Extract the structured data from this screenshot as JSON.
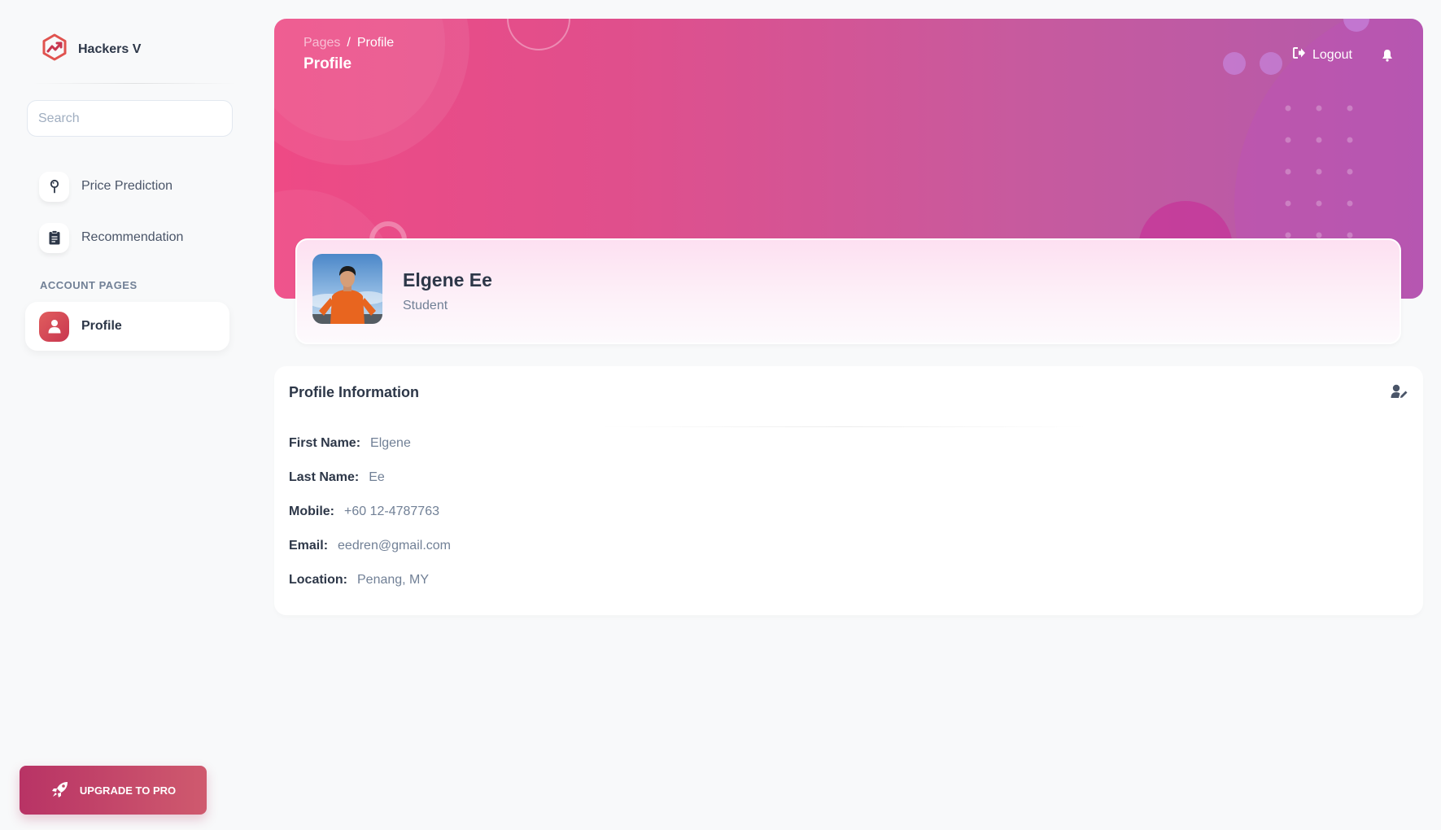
{
  "brand": {
    "name": "Hackers V"
  },
  "search": {
    "placeholder": "Search"
  },
  "sidebar": {
    "items": [
      {
        "label": "Price Prediction",
        "icon": "map-pin-icon"
      },
      {
        "label": "Recommendation",
        "icon": "clipboard-icon"
      }
    ],
    "section_title": "ACCOUNT PAGES",
    "account_items": [
      {
        "label": "Profile",
        "icon": "user-icon",
        "active": true
      }
    ],
    "upgrade_label": "UPGRADE TO PRO"
  },
  "header": {
    "breadcrumb_root": "Pages",
    "breadcrumb_sep": "/",
    "breadcrumb_current": "Profile",
    "title": "Profile",
    "logout_label": "Logout"
  },
  "profile": {
    "name": "Elgene Ee",
    "role": "Student"
  },
  "info": {
    "title": "Profile Information",
    "fields": [
      {
        "label": "First Name:",
        "value": "Elgene"
      },
      {
        "label": "Last Name:",
        "value": "Ee"
      },
      {
        "label": "Mobile:",
        "value": "+60 12-4787763"
      },
      {
        "label": "Email:",
        "value": "eedren@gmail.com"
      },
      {
        "label": "Location:",
        "value": "Penang, MY"
      }
    ]
  },
  "colors": {
    "accent": "#e15e5e",
    "banner_start": "#ee4a85",
    "banner_end": "#b35aab",
    "upgrade_start": "#b83365",
    "upgrade_end": "#cf5a6e"
  }
}
